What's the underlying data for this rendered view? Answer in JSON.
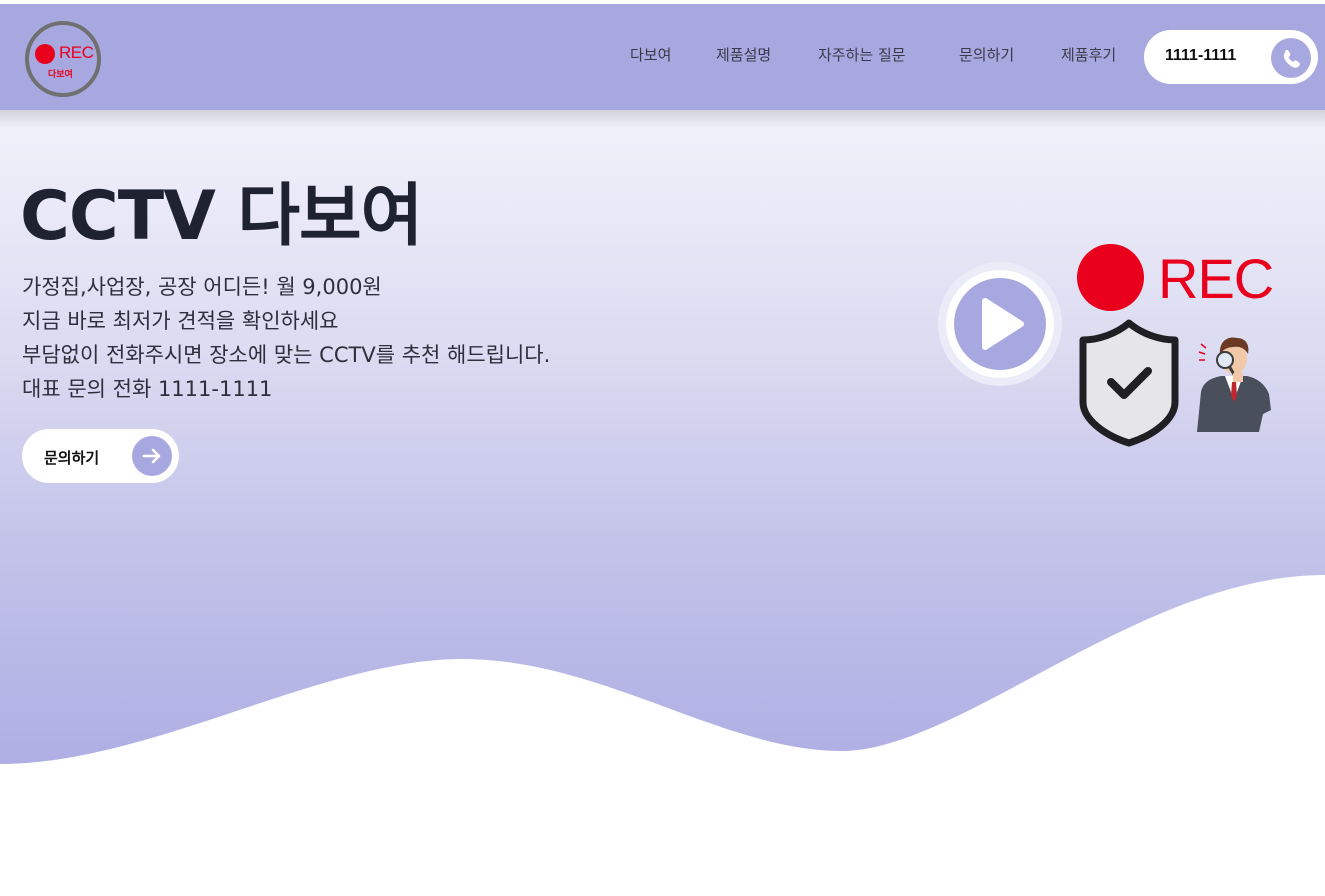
{
  "header": {
    "logo": {
      "text": "REC",
      "subtext": "다보여"
    },
    "nav": [
      {
        "label": "다보여"
      },
      {
        "label": "제품설명"
      },
      {
        "label": "자주하는 질문"
      },
      {
        "label": "문의하기"
      },
      {
        "label": "제품후기"
      }
    ],
    "phone": {
      "number": "1111-1111",
      "icon": "phone-icon"
    }
  },
  "hero": {
    "title": "CCTV 다보여",
    "lines": [
      "가정집,사업장, 공장 어디든! 월 9,000원",
      "지금 바로 최저가 견적을 확인하세요",
      "부담없이 전화주시면 장소에 맞는 CCTV를 추천 해드립니다.",
      "대표 문의 전화 1111-1111"
    ],
    "cta": {
      "label": "문의하기",
      "icon": "arrow-right-icon"
    },
    "illustration": {
      "rec_text": "REC",
      "icons": [
        "play-icon",
        "record-dot-icon",
        "shield-check-icon",
        "detective-person-icon"
      ]
    }
  },
  "colors": {
    "accent": "#a8a8e0",
    "rec_red": "#e8001c",
    "title": "#1f2230"
  }
}
